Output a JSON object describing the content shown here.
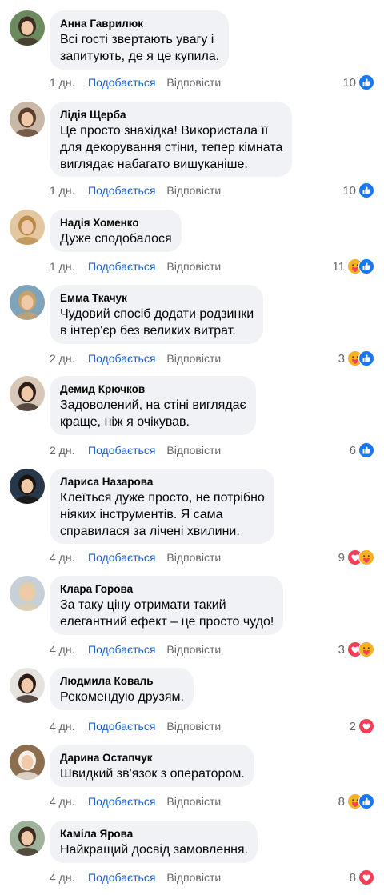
{
  "actions": {
    "like_label": "Подобається",
    "reply_label": "Відповісти"
  },
  "comments": [
    {
      "author": "Анна Гаврилюк",
      "text": "Всі гості звертають увагу і\nзапитують, де я це купила.",
      "time": "1 дн.",
      "count": "10",
      "reactions": [
        "like-icon"
      ]
    },
    {
      "author": "Лідія Щерба",
      "text": "Це просто знахідка! Використала її\nдля декорування стіни, тепер кімната\nвиглядає набагато вишуканіше.",
      "time": "1 дн.",
      "count": "10",
      "reactions": [
        "like-icon"
      ]
    },
    {
      "author": "Надія Хоменко",
      "text": "Дуже сподобалося",
      "time": "1 дн.",
      "count": "11",
      "reactions": [
        "care-icon",
        "like-icon"
      ]
    },
    {
      "author": "Емма Ткачук",
      "text": "Чудовий спосіб додати родзинки\nв інтер'єр без великих витрат.",
      "time": "2 дн.",
      "count": "3",
      "reactions": [
        "care-icon",
        "like-icon"
      ]
    },
    {
      "author": "Демид Крючков",
      "text": "Задоволений, на стіні виглядає\nкраще, ніж я очікував.",
      "time": "2 дн.",
      "count": "6",
      "reactions": [
        "like-icon"
      ]
    },
    {
      "author": "Лариса Назарова",
      "text": "Клеїться дуже просто, не потрібно\nніяких інструментів. Я сама\nсправилася за лічені хвилини.",
      "time": "4 дн.",
      "count": "9",
      "reactions": [
        "love-icon",
        "care-icon"
      ]
    },
    {
      "author": "Клара Горова",
      "text": "За таку ціну отримати такий\nелегантний ефект – це просто чудо!",
      "time": "4 дн.",
      "count": "3",
      "reactions": [
        "love-icon",
        "care-icon"
      ]
    },
    {
      "author": "Людмила Коваль",
      "text": "Рекомендую друзям.",
      "time": "4 дн.",
      "count": "2",
      "reactions": [
        "love-icon"
      ]
    },
    {
      "author": "Дарина Остапчук",
      "text": "Швидкий зв'язок з оператором.",
      "time": "4 дн.",
      "count": "8",
      "reactions": [
        "care-icon",
        "like-icon"
      ]
    },
    {
      "author": "Каміла Ярова",
      "text": "Найкращий досвід замовлення.",
      "time": "4 дн.",
      "count": "8",
      "reactions": [
        "love-icon"
      ]
    }
  ],
  "colors": {
    "like_blue": "#1877f2",
    "love_red": "#f33e58",
    "care_yellow": "#f7b125",
    "link_blue": "#1b5ec9",
    "bubble_gray": "#f0f2f5"
  }
}
